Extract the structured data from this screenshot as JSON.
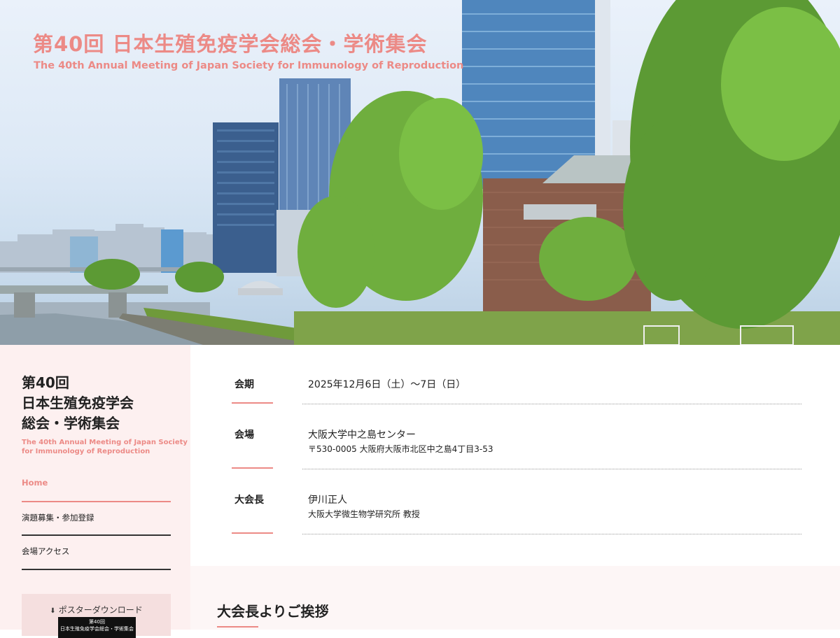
{
  "hero": {
    "title": "第40回 日本生殖免疫学会総会・学術集会",
    "subtitle": "The 40th Annual Meeting of Japan Society for Immunology of Reproduction"
  },
  "sidebar": {
    "title_lines": [
      "第40回",
      "日本生殖免疫学会",
      "総会・学術集会"
    ],
    "subtitle_lines": [
      "The 40th Annual Meeting of Japan Society",
      "for Immunology of Reproduction"
    ],
    "nav": [
      {
        "label": "Home",
        "active": true
      },
      {
        "label": "演題募集・参加登録",
        "active": false
      },
      {
        "label": "会場アクセス",
        "active": false
      }
    ],
    "poster": {
      "label": "ポスターダウンロード",
      "thumb_line1": "第40回",
      "thumb_line2": "日本生殖免疫学会総会・学術集会"
    }
  },
  "info": {
    "rows": [
      {
        "label": "会期",
        "value": "2025年12月6日（土）〜7日（日）",
        "sub": ""
      },
      {
        "label": "会場",
        "value": "大阪大学中之島センター",
        "sub": "〒530-0005 大阪府大阪市北区中之島4丁目3-53"
      },
      {
        "label": "大会長",
        "value": "伊川正人",
        "sub": "大阪大学微生物学研究所 教授"
      }
    ]
  },
  "greeting": {
    "title": "大会長よりご挨拶"
  },
  "colors": {
    "accent": "#ec8a86",
    "sidebar_bg": "#fdf0f0",
    "poster_bg": "#f5dfdf"
  },
  "icons": {
    "download": "download-icon"
  }
}
